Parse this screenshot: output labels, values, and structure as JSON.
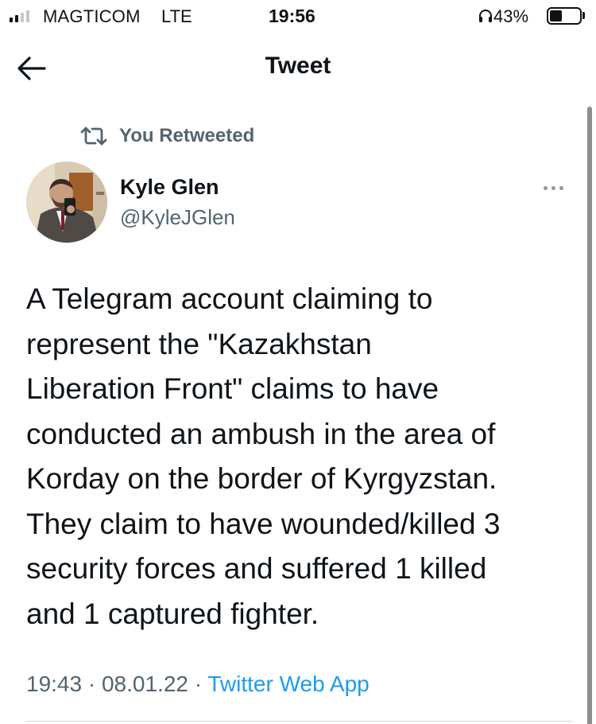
{
  "status_bar": {
    "carrier": "MAGTICOM",
    "network": "LTE",
    "time": "19:56",
    "battery_percent": "43%",
    "battery_level": 0.43,
    "signal_bars_filled": 2,
    "signal_bars_total": 4,
    "icons": [
      "signal-icon",
      "headphones-icon",
      "battery-icon"
    ]
  },
  "header": {
    "title": "Tweet",
    "back_icon": "arrow-left-icon"
  },
  "retweet_context": {
    "icon": "retweet-icon",
    "label": "You Retweeted"
  },
  "author": {
    "name": "Kyle Glen",
    "handle": "@KyleJGlen",
    "more_icon": "more-horizontal-icon"
  },
  "tweet": {
    "text_lines": [
      "A Telegram account claiming to",
      "represent the \"Kazakhstan",
      "Liberation Front\" claims to have",
      "conducted an ambush in the area of",
      "Korday on the border of Kyrgyzstan.",
      "They claim to have wounded/killed 3",
      "security forces and suffered 1 killed",
      "and 1 captured fighter."
    ],
    "time": "19:43",
    "date": "08.01.22",
    "separator": "·",
    "source": "Twitter Web App"
  },
  "colors": {
    "text": "#0f1419",
    "secondary_text": "#536471",
    "link": "#1d9bf0",
    "divider": "#cfd9de"
  }
}
